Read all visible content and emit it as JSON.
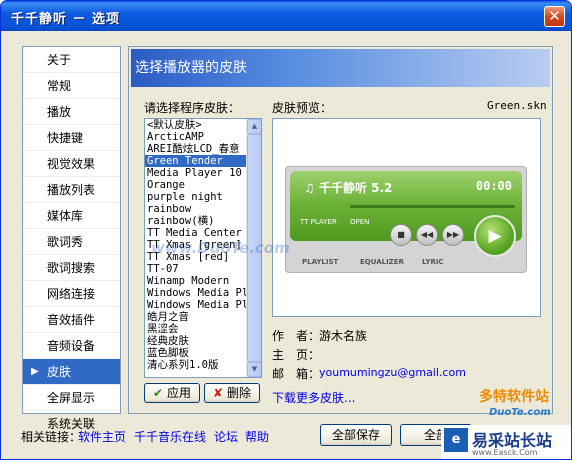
{
  "window": {
    "title": "千千静听 － 选项"
  },
  "nav": {
    "items": [
      "关于",
      "常规",
      "播放",
      "快捷键",
      "视觉效果",
      "播放列表",
      "媒体库",
      "歌词秀",
      "歌词搜索",
      "网络连接",
      "音效插件",
      "音频设备",
      "皮肤",
      "全屏显示",
      "系统关联"
    ],
    "selected_index": 12
  },
  "panel": {
    "header": "选择播放器的皮肤",
    "list_label": "请选择程序皮肤：",
    "preview_label": "皮肤预览：",
    "preview_file": "Green.skn",
    "skins": [
      "<默认皮肤>",
      "ArcticAMP",
      "AREI酷炫LCD_春意",
      "Green Tender",
      "Media Player 10",
      "Orange",
      "purple night",
      "rainbow",
      "rainbow(横)",
      "TT Media Center",
      "TT Xmas [green]",
      "TT Xmas [red]",
      "TT-07",
      "Winamp Modern",
      "Windows Media Pl",
      "Windows Media Pl",
      "皓月之音",
      "黑涩会",
      "经典皮肤",
      "蓝色脚板",
      "清心系列1.0版"
    ],
    "selected_skin_index": 3,
    "apply_label": "应用",
    "delete_label": "删除",
    "author_label": "作　者：",
    "author_value": "游木名族",
    "homepage_label": "主　页：",
    "homepage_value": "",
    "email_label": "邮　箱：",
    "email_value": "youmumingzu@gmail.com",
    "download_more": "下载更多皮肤..."
  },
  "player": {
    "title": "千千静听 5.2",
    "time": "00:00",
    "brand_small": "TT PLAYER",
    "open_label": "OPEN",
    "tabs": [
      "PLAYLIST",
      "EQUALIZER",
      "LYRIC"
    ]
  },
  "footer": {
    "related_label": "相关链接：",
    "links": [
      "软件主页",
      "千千音乐在线",
      "论坛",
      "帮助"
    ],
    "save_all": "全部保存",
    "restore_all": "全部"
  },
  "watermarks": {
    "duote": "www.DuoTe.com",
    "duote_cn": "多特软件站",
    "duote_domain": "DuoTe.com",
    "yicai": "易采站长站",
    "yicai_url": "www.Easck.Com"
  },
  "colors": {
    "selection": "#316ac5",
    "titlebar": "#0653d6",
    "link": "#0000ee",
    "player_green": "#6eb238"
  }
}
